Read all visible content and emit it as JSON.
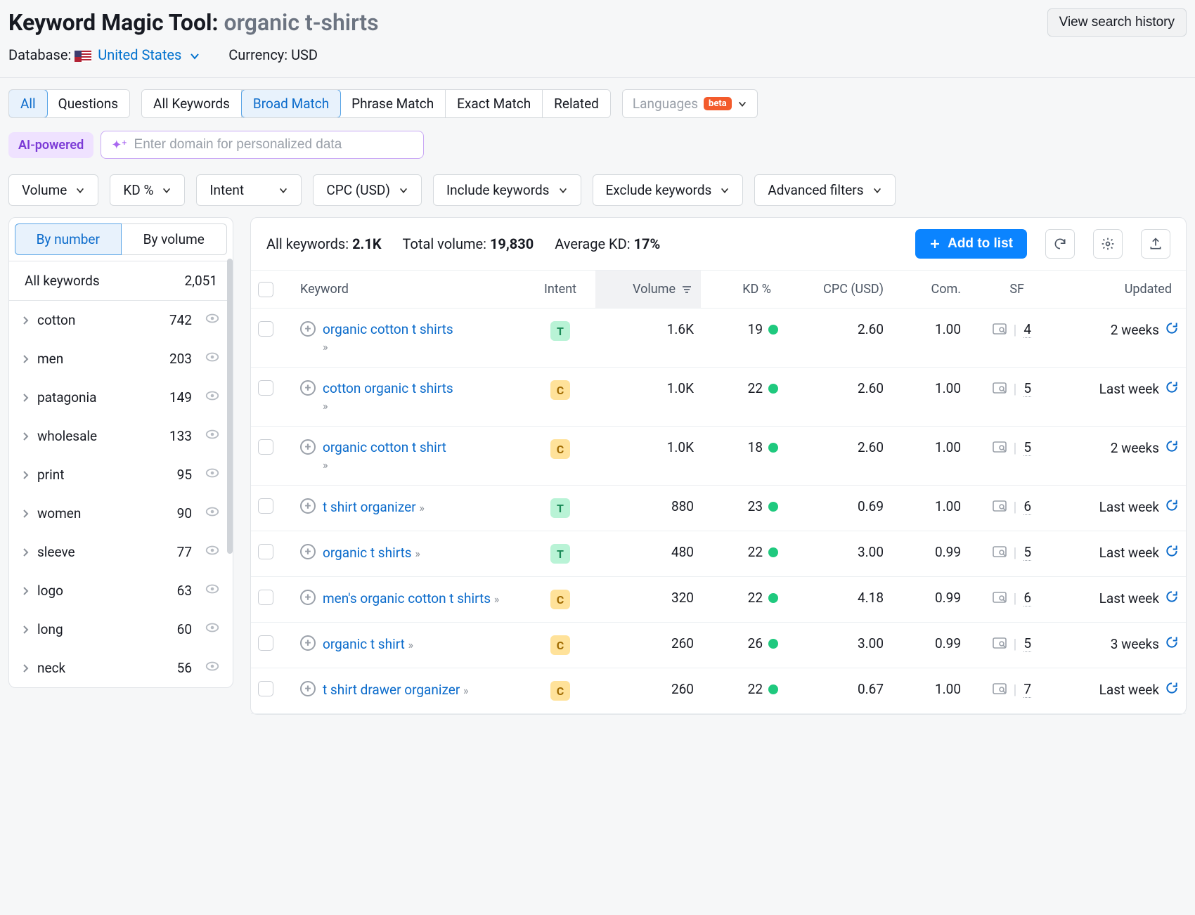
{
  "header": {
    "tool_name": "Keyword Magic Tool:",
    "query": "organic t-shirts",
    "view_history": "View search history",
    "database_label": "Database:",
    "database_value": "United States",
    "currency_label": "Currency: USD"
  },
  "tabs_group1": {
    "all": "All",
    "questions": "Questions"
  },
  "tabs_group2": {
    "allkw": "All Keywords",
    "broad": "Broad Match",
    "phrase": "Phrase Match",
    "exact": "Exact Match",
    "related": "Related"
  },
  "lang_btn": {
    "label": "Languages",
    "badge": "beta"
  },
  "ai": {
    "chip": "AI-powered",
    "placeholder": "Enter domain for personalized data"
  },
  "filters": {
    "volume": "Volume",
    "kd": "KD %",
    "intent": "Intent",
    "cpc": "CPC (USD)",
    "include": "Include keywords",
    "exclude": "Exclude keywords",
    "advanced": "Advanced filters"
  },
  "sidebar": {
    "tab_number": "By number",
    "tab_volume": "By volume",
    "all_label": "All keywords",
    "all_count": "2,051",
    "items": [
      {
        "label": "cotton",
        "count": "742"
      },
      {
        "label": "men",
        "count": "203"
      },
      {
        "label": "patagonia",
        "count": "149"
      },
      {
        "label": "wholesale",
        "count": "133"
      },
      {
        "label": "print",
        "count": "95"
      },
      {
        "label": "women",
        "count": "90"
      },
      {
        "label": "sleeve",
        "count": "77"
      },
      {
        "label": "logo",
        "count": "63"
      },
      {
        "label": "long",
        "count": "60"
      },
      {
        "label": "neck",
        "count": "56"
      }
    ]
  },
  "stats": {
    "allkw_label": "All keywords: ",
    "allkw_val": "2.1K",
    "totvol_label": "Total volume: ",
    "totvol_val": "19,830",
    "avgkd_label": "Average KD: ",
    "avgkd_val": "17%"
  },
  "actions": {
    "add_to_list": "Add to list"
  },
  "columns": {
    "keyword": "Keyword",
    "intent": "Intent",
    "volume": "Volume",
    "kd": "KD %",
    "cpc": "CPC (USD)",
    "com": "Com.",
    "sf": "SF",
    "updated": "Updated"
  },
  "rows": [
    {
      "kw": "organic cotton t shirts",
      "intent": "T",
      "vol": "1.6K",
      "kd": "19",
      "cpc": "2.60",
      "com": "1.00",
      "sf": "4",
      "upd": "2 weeks",
      "wrap": true
    },
    {
      "kw": "cotton organic t shirts",
      "intent": "C",
      "vol": "1.0K",
      "kd": "22",
      "cpc": "2.60",
      "com": "1.00",
      "sf": "5",
      "upd": "Last week",
      "wrap": true
    },
    {
      "kw": "organic cotton t shirt",
      "intent": "C",
      "vol": "1.0K",
      "kd": "18",
      "cpc": "2.60",
      "com": "1.00",
      "sf": "5",
      "upd": "2 weeks",
      "wrap": true
    },
    {
      "kw": "t shirt organizer",
      "intent": "T",
      "vol": "880",
      "kd": "23",
      "cpc": "0.69",
      "com": "1.00",
      "sf": "6",
      "upd": "Last week",
      "wrap": false
    },
    {
      "kw": "organic t shirts",
      "intent": "T",
      "vol": "480",
      "kd": "22",
      "cpc": "3.00",
      "com": "0.99",
      "sf": "5",
      "upd": "Last week",
      "wrap": false
    },
    {
      "kw": "men's organic cotton t shirts",
      "intent": "C",
      "vol": "320",
      "kd": "22",
      "cpc": "4.18",
      "com": "0.99",
      "sf": "6",
      "upd": "Last week",
      "wrap": false
    },
    {
      "kw": "organic t shirt",
      "intent": "C",
      "vol": "260",
      "kd": "26",
      "cpc": "3.00",
      "com": "0.99",
      "sf": "5",
      "upd": "3 weeks",
      "wrap": false
    },
    {
      "kw": "t shirt drawer organizer",
      "intent": "C",
      "vol": "260",
      "kd": "22",
      "cpc": "0.67",
      "com": "1.00",
      "sf": "7",
      "upd": "Last week",
      "wrap": false
    }
  ]
}
